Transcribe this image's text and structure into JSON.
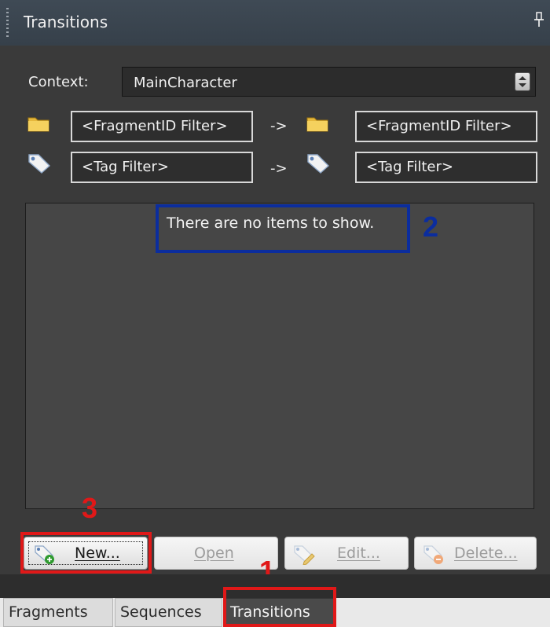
{
  "panel": {
    "title": "Transitions"
  },
  "context": {
    "label": "Context:",
    "value": "MainCharacter"
  },
  "filters": {
    "fragment_from": "<FragmentID Filter>",
    "fragment_to": "<FragmentID Filter>",
    "tag_from": "<Tag Filter>",
    "tag_to": "<Tag Filter>",
    "arrow": "->"
  },
  "list": {
    "empty_message": "There are no items to show."
  },
  "buttons": {
    "new": "New...",
    "open": "Open",
    "edit": "Edit...",
    "delete": "Delete..."
  },
  "tabs": [
    "Fragments",
    "Sequences",
    "Transitions"
  ],
  "annotations": {
    "one": "1",
    "two": "2",
    "three": "3"
  },
  "colors": {
    "annotation_red": "#e01818",
    "annotation_blue": "#0b2d9e"
  }
}
